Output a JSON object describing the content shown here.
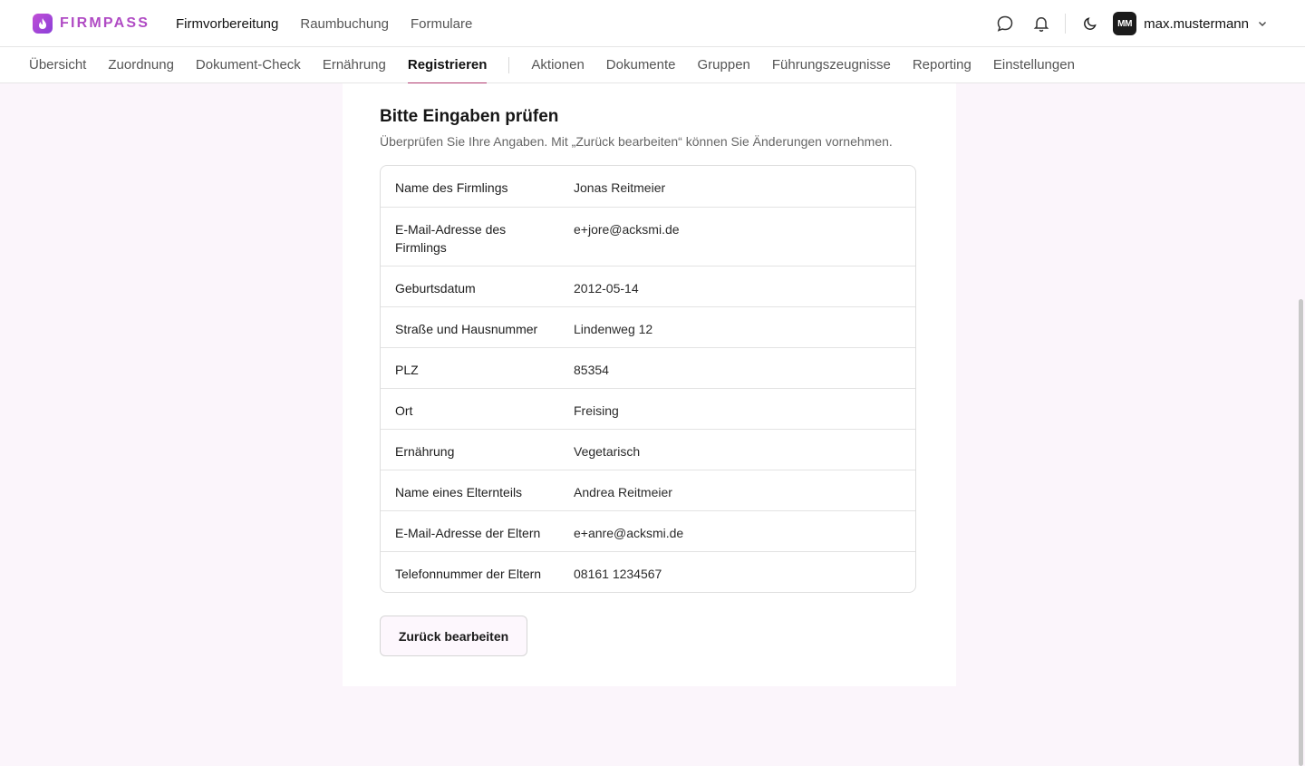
{
  "brand": {
    "name": "FIRMPASS",
    "accent": "#b04bc4"
  },
  "mainnav": [
    {
      "label": "Firmvorbereitung",
      "active": true
    },
    {
      "label": "Raumbuchung",
      "active": false
    },
    {
      "label": "Formulare",
      "active": false
    }
  ],
  "user": {
    "initials": "MM",
    "name": "max.mustermann"
  },
  "subnav": [
    {
      "label": "Übersicht"
    },
    {
      "label": "Zuordnung"
    },
    {
      "label": "Dokument-Check"
    },
    {
      "label": "Ernährung"
    },
    {
      "label": "Registrieren",
      "active": true
    },
    {
      "label": "Aktionen"
    },
    {
      "label": "Dokumente"
    },
    {
      "label": "Gruppen"
    },
    {
      "label": "Führungszeugnisse"
    },
    {
      "label": "Reporting"
    },
    {
      "label": "Einstellungen"
    }
  ],
  "review": {
    "title": "Bitte Eingaben prüfen",
    "subtitle": "Überprüfen Sie Ihre Angaben. Mit „Zurück bearbeiten“ können Sie Änderungen vornehmen.",
    "rows": [
      {
        "label": "Name des Firmlings",
        "value": "Jonas Reitmeier"
      },
      {
        "label": "E-Mail-Adresse des Firmlings",
        "value": "e+jore@acksmi.de"
      },
      {
        "label": "Geburtsdatum",
        "value": "2012-05-14"
      },
      {
        "label": "Straße und Hausnummer",
        "value": "Lindenweg 12"
      },
      {
        "label": "PLZ",
        "value": "85354"
      },
      {
        "label": "Ort",
        "value": "Freising"
      },
      {
        "label": "Ernährung",
        "value": "Vegetarisch"
      },
      {
        "label": "Name eines Elternteils",
        "value": "Andrea Reitmeier"
      },
      {
        "label": "E-Mail-Adresse der Eltern",
        "value": "e+anre@acksmi.de"
      },
      {
        "label": "Telefonnummer der Eltern",
        "value": "08161 1234567"
      }
    ],
    "back_label": "Zurück bearbeiten"
  },
  "icons": {
    "chat": "chat-bubble-icon",
    "bell": "bell-icon",
    "theme": "moon-icon",
    "chevron": "chevron-down-icon"
  }
}
